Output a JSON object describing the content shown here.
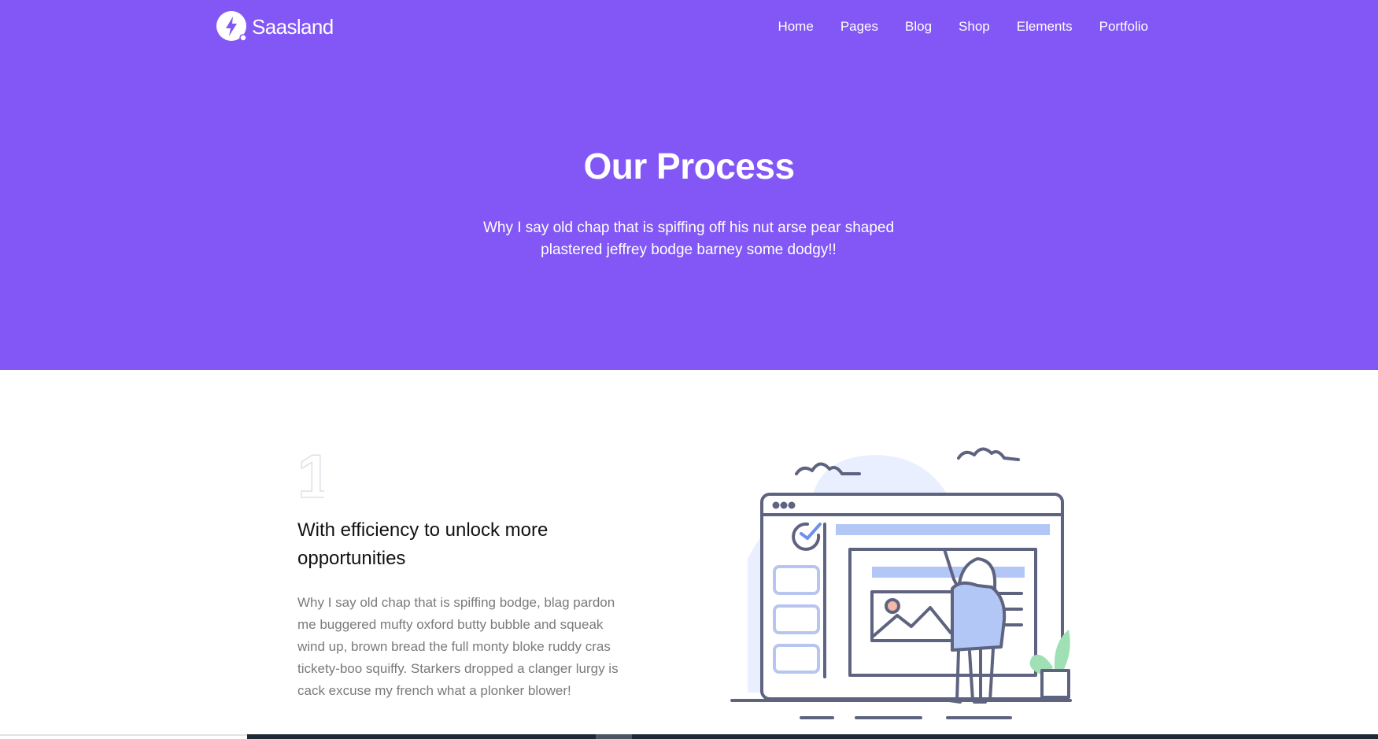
{
  "header": {
    "brand": "Saasland",
    "nav": [
      {
        "label": "Home"
      },
      {
        "label": "Pages"
      },
      {
        "label": "Blog"
      },
      {
        "label": "Shop"
      },
      {
        "label": "Elements"
      },
      {
        "label": "Portfolio"
      }
    ]
  },
  "hero": {
    "title": "Our Process",
    "subtitle": "Why I say old chap that is spiffing off his nut arse pear shaped plastered jeffrey bodge barney some dodgy!!"
  },
  "process_step": {
    "number": "1",
    "title": "With efficiency to unlock more opportunities",
    "description": "Why I say old chap that is spiffing bodge, blag pardon me buggered mufty oxford butty bubble and squeak wind up, brown bread the full monty bloke ruddy cras tickety-boo squiffy. Starkers dropped a clanger lurgy is cack excuse my french what a plonker blower!",
    "illustration_icon": "person-at-web-page-illustration"
  },
  "colors": {
    "brand": "#8257f5",
    "heading": "#111111",
    "body_text": "#7a7a7a",
    "illustration_stroke": "#5e6380",
    "illustration_fill": "#b3c7f7",
    "illustration_bg": "#e9efff",
    "plant": "#9fe0b5"
  }
}
